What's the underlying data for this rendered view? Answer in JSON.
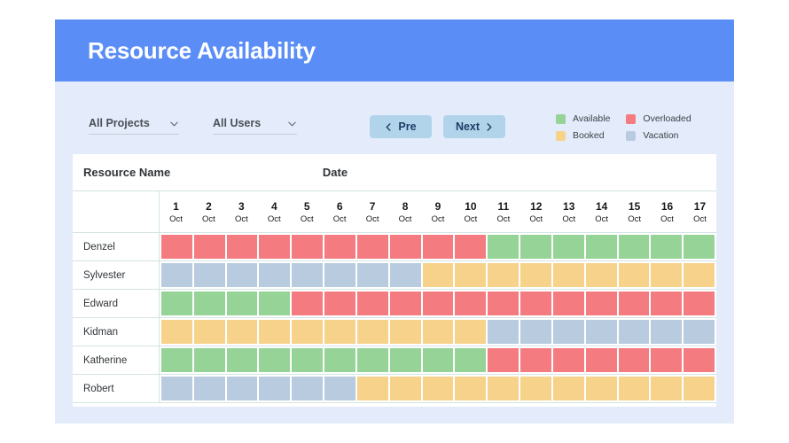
{
  "header": {
    "title": "Resource Availability",
    "banner_color": "#5b8df6"
  },
  "toolbar": {
    "project_filter": {
      "label": "All Projects",
      "icon": "chevron-down-icon"
    },
    "user_filter": {
      "label": "All Users",
      "icon": "chevron-down-icon"
    },
    "prev_button": {
      "label": "Pre",
      "icon": "chevron-left-icon"
    },
    "next_button": {
      "label": "Next",
      "icon": "chevron-right-icon"
    }
  },
  "legend": [
    {
      "label": "Available",
      "color": "#95d397"
    },
    {
      "label": "Overloaded",
      "color": "#f47b80"
    },
    {
      "label": "Booked",
      "color": "#f7d28a"
    },
    {
      "label": "Vacation",
      "color": "#b8cbdf"
    }
  ],
  "table": {
    "resource_header": "Resource Name",
    "date_header": "Date",
    "dates": [
      {
        "day": "1",
        "month": "Oct"
      },
      {
        "day": "2",
        "month": "Oct"
      },
      {
        "day": "3",
        "month": "Oct"
      },
      {
        "day": "4",
        "month": "Oct"
      },
      {
        "day": "5",
        "month": "Oct"
      },
      {
        "day": "6",
        "month": "Oct"
      },
      {
        "day": "7",
        "month": "Oct"
      },
      {
        "day": "8",
        "month": "Oct"
      },
      {
        "day": "9",
        "month": "Oct"
      },
      {
        "day": "10",
        "month": "Oct"
      },
      {
        "day": "11",
        "month": "Oct"
      },
      {
        "day": "12",
        "month": "Oct"
      },
      {
        "day": "13",
        "month": "Oct"
      },
      {
        "day": "14",
        "month": "Oct"
      },
      {
        "day": "15",
        "month": "Oct"
      },
      {
        "day": "16",
        "month": "Oct"
      },
      {
        "day": "17",
        "month": "Oct"
      }
    ],
    "status_colors": {
      "available": "#95d397",
      "overloaded": "#f47b80",
      "booked": "#f7d28a",
      "vacation": "#b8cbdf"
    },
    "rows": [
      {
        "name": "Denzel",
        "statuses": [
          "overloaded",
          "overloaded",
          "overloaded",
          "overloaded",
          "overloaded",
          "overloaded",
          "overloaded",
          "overloaded",
          "overloaded",
          "overloaded",
          "available",
          "available",
          "available",
          "available",
          "available",
          "available",
          "available"
        ]
      },
      {
        "name": "Sylvester",
        "statuses": [
          "vacation",
          "vacation",
          "vacation",
          "vacation",
          "vacation",
          "vacation",
          "vacation",
          "vacation",
          "booked",
          "booked",
          "booked",
          "booked",
          "booked",
          "booked",
          "booked",
          "booked",
          "booked"
        ]
      },
      {
        "name": "Edward",
        "statuses": [
          "available",
          "available",
          "available",
          "available",
          "overloaded",
          "overloaded",
          "overloaded",
          "overloaded",
          "overloaded",
          "overloaded",
          "overloaded",
          "overloaded",
          "overloaded",
          "overloaded",
          "overloaded",
          "overloaded",
          "overloaded"
        ]
      },
      {
        "name": "Kidman",
        "statuses": [
          "booked",
          "booked",
          "booked",
          "booked",
          "booked",
          "booked",
          "booked",
          "booked",
          "booked",
          "booked",
          "vacation",
          "vacation",
          "vacation",
          "vacation",
          "vacation",
          "vacation",
          "vacation"
        ]
      },
      {
        "name": "Katherine",
        "statuses": [
          "available",
          "available",
          "available",
          "available",
          "available",
          "available",
          "available",
          "available",
          "available",
          "available",
          "overloaded",
          "overloaded",
          "overloaded",
          "overloaded",
          "overloaded",
          "overloaded",
          "overloaded"
        ]
      },
      {
        "name": "Robert",
        "statuses": [
          "vacation",
          "vacation",
          "vacation",
          "vacation",
          "vacation",
          "vacation",
          "booked",
          "booked",
          "booked",
          "booked",
          "booked",
          "booked",
          "booked",
          "booked",
          "booked",
          "booked",
          "booked"
        ]
      }
    ]
  }
}
